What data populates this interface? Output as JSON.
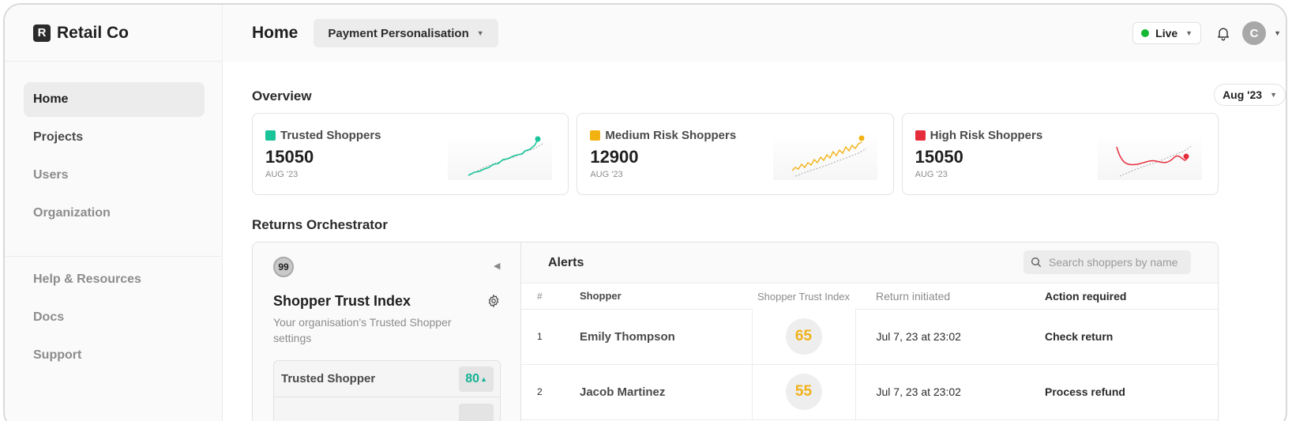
{
  "brand": {
    "logo_letter": "R",
    "name": "Retail Co"
  },
  "sidebar": {
    "items": [
      {
        "label": "Home"
      },
      {
        "label": "Projects"
      },
      {
        "label": "Users"
      },
      {
        "label": "Organization"
      }
    ],
    "secondary": [
      {
        "label": "Help & Resources"
      },
      {
        "label": "Docs"
      },
      {
        "label": "Support"
      }
    ]
  },
  "header": {
    "title": "Home",
    "context_selector": "Payment Personalisation",
    "environment": "Live",
    "avatar_initial": "C"
  },
  "overview": {
    "title": "Overview",
    "period": "Aug '23",
    "cards": [
      {
        "label": "Trusted Shoppers",
        "value": "15050",
        "period": "AUG '23",
        "color": "#19c49a"
      },
      {
        "label": "Medium Risk Shoppers",
        "value": "12900",
        "period": "AUG '23",
        "color": "#f2b312"
      },
      {
        "label": "High Risk Shoppers",
        "value": "15050",
        "period": "AUG '23",
        "color": "#e52d3c"
      }
    ]
  },
  "orchestrator": {
    "title": "Returns Orchestrator",
    "badge": "99",
    "index_title": "Shopper Trust Index",
    "index_desc": "Your organisation's Trusted Shopper settings",
    "levels": [
      {
        "label": "Trusted Shopper",
        "score": "80",
        "trend": "▲"
      }
    ]
  },
  "alerts": {
    "title": "Alerts",
    "search_placeholder": "Search shoppers by name",
    "columns": {
      "num": "#",
      "shopper": "Shopper",
      "sti": "Shopper Trust Index",
      "returned": "Return initiated",
      "action": "Action required"
    },
    "rows": [
      {
        "num": "1",
        "shopper": "Emily Thompson",
        "sti": "65",
        "returned": "Jul 7, 23 at 23:02",
        "action": "Check return"
      },
      {
        "num": "2",
        "shopper": "Jacob Martinez",
        "sti": "55",
        "returned": "Jul 7, 23 at 23:02",
        "action": "Process refund"
      }
    ]
  },
  "colors": {
    "trusted": "#19c49a",
    "medium": "#f2b312",
    "high": "#e52d3c",
    "live": "#14b834"
  }
}
